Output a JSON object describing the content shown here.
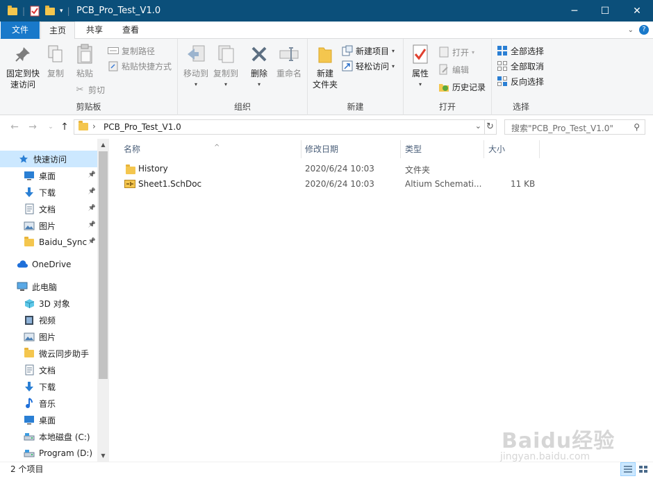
{
  "window": {
    "title": "PCB_Pro_Test_V1.0",
    "controls": {
      "minimize": "─",
      "maximize": "☐",
      "close": "✕"
    },
    "accent_color": "#0b4f7a"
  },
  "ribbon_tabs": [
    {
      "label": "文件"
    },
    {
      "label": "主页"
    },
    {
      "label": "共享"
    },
    {
      "label": "查看"
    }
  ],
  "ribbon": {
    "clipboard": {
      "group_label": "剪贴板",
      "pin_quick_access": [
        "固定到快",
        "速访问"
      ],
      "copy": "复制",
      "paste": "粘贴",
      "copy_path": "复制路径",
      "paste_shortcut": "粘贴快捷方式",
      "cut": "剪切"
    },
    "organize": {
      "group_label": "组织",
      "move_to": "移动到",
      "copy_to": "复制到",
      "delete": "删除",
      "rename": "重命名"
    },
    "new": {
      "group_label": "新建",
      "new_folder": [
        "新建",
        "文件夹"
      ],
      "new_item": "新建项目",
      "easy_access": "轻松访问"
    },
    "open": {
      "group_label": "打开",
      "properties": "属性",
      "open": "打开",
      "edit": "编辑",
      "history": "历史记录"
    },
    "select": {
      "group_label": "选择",
      "select_all": "全部选择",
      "select_none": "全部取消",
      "invert_selection": "反向选择"
    }
  },
  "address": {
    "path": "PCB_Pro_Test_V1.0",
    "separator": "›",
    "search_placeholder": "搜索\"PCB_Pro_Test_V1.0\""
  },
  "nav_pane": {
    "items": [
      {
        "label": "快速访问",
        "icon": "star-icon",
        "pinned": false
      },
      {
        "label": "桌面",
        "icon": "desktop-icon",
        "pinned": true
      },
      {
        "label": "下载",
        "icon": "download-icon",
        "pinned": true
      },
      {
        "label": "文档",
        "icon": "document-icon",
        "pinned": true
      },
      {
        "label": "图片",
        "icon": "picture-icon",
        "pinned": true
      },
      {
        "label": "Baidu_Sync",
        "icon": "folder-icon",
        "pinned": true
      },
      {
        "label": "OneDrive",
        "icon": "cloud-icon",
        "pinned": false
      },
      {
        "label": "此电脑",
        "icon": "pc-icon",
        "pinned": false
      },
      {
        "label": "3D 对象",
        "icon": "cube-icon",
        "pinned": false
      },
      {
        "label": "视频",
        "icon": "video-icon",
        "pinned": false
      },
      {
        "label": "图片",
        "icon": "picture-icon",
        "pinned": false
      },
      {
        "label": "微云同步助手",
        "icon": "folder-icon",
        "pinned": false
      },
      {
        "label": "文档",
        "icon": "document-icon",
        "pinned": false
      },
      {
        "label": "下载",
        "icon": "download-icon",
        "pinned": false
      },
      {
        "label": "音乐",
        "icon": "music-icon",
        "pinned": false
      },
      {
        "label": "桌面",
        "icon": "desktop-icon",
        "pinned": false
      },
      {
        "label": "本地磁盘 (C:)",
        "icon": "drive-icon",
        "pinned": false
      },
      {
        "label": "Program (D:)",
        "icon": "drive-icon",
        "pinned": false
      }
    ]
  },
  "file_list": {
    "columns": [
      "名称",
      "修改日期",
      "类型",
      "大小"
    ],
    "rows": [
      {
        "name": "History",
        "date": "2020/6/24 10:03",
        "type": "文件夹",
        "size": "",
        "icon": "folder-icon"
      },
      {
        "name": "Sheet1.SchDoc",
        "date": "2020/6/24 10:03",
        "type": "Altium Schemati...",
        "size": "11 KB",
        "icon": "schdoc-file-icon"
      }
    ]
  },
  "status_bar": {
    "item_count": "2 个项目"
  },
  "watermark": {
    "main": "Baidu经验",
    "sub": "jingyan.baidu.com"
  }
}
